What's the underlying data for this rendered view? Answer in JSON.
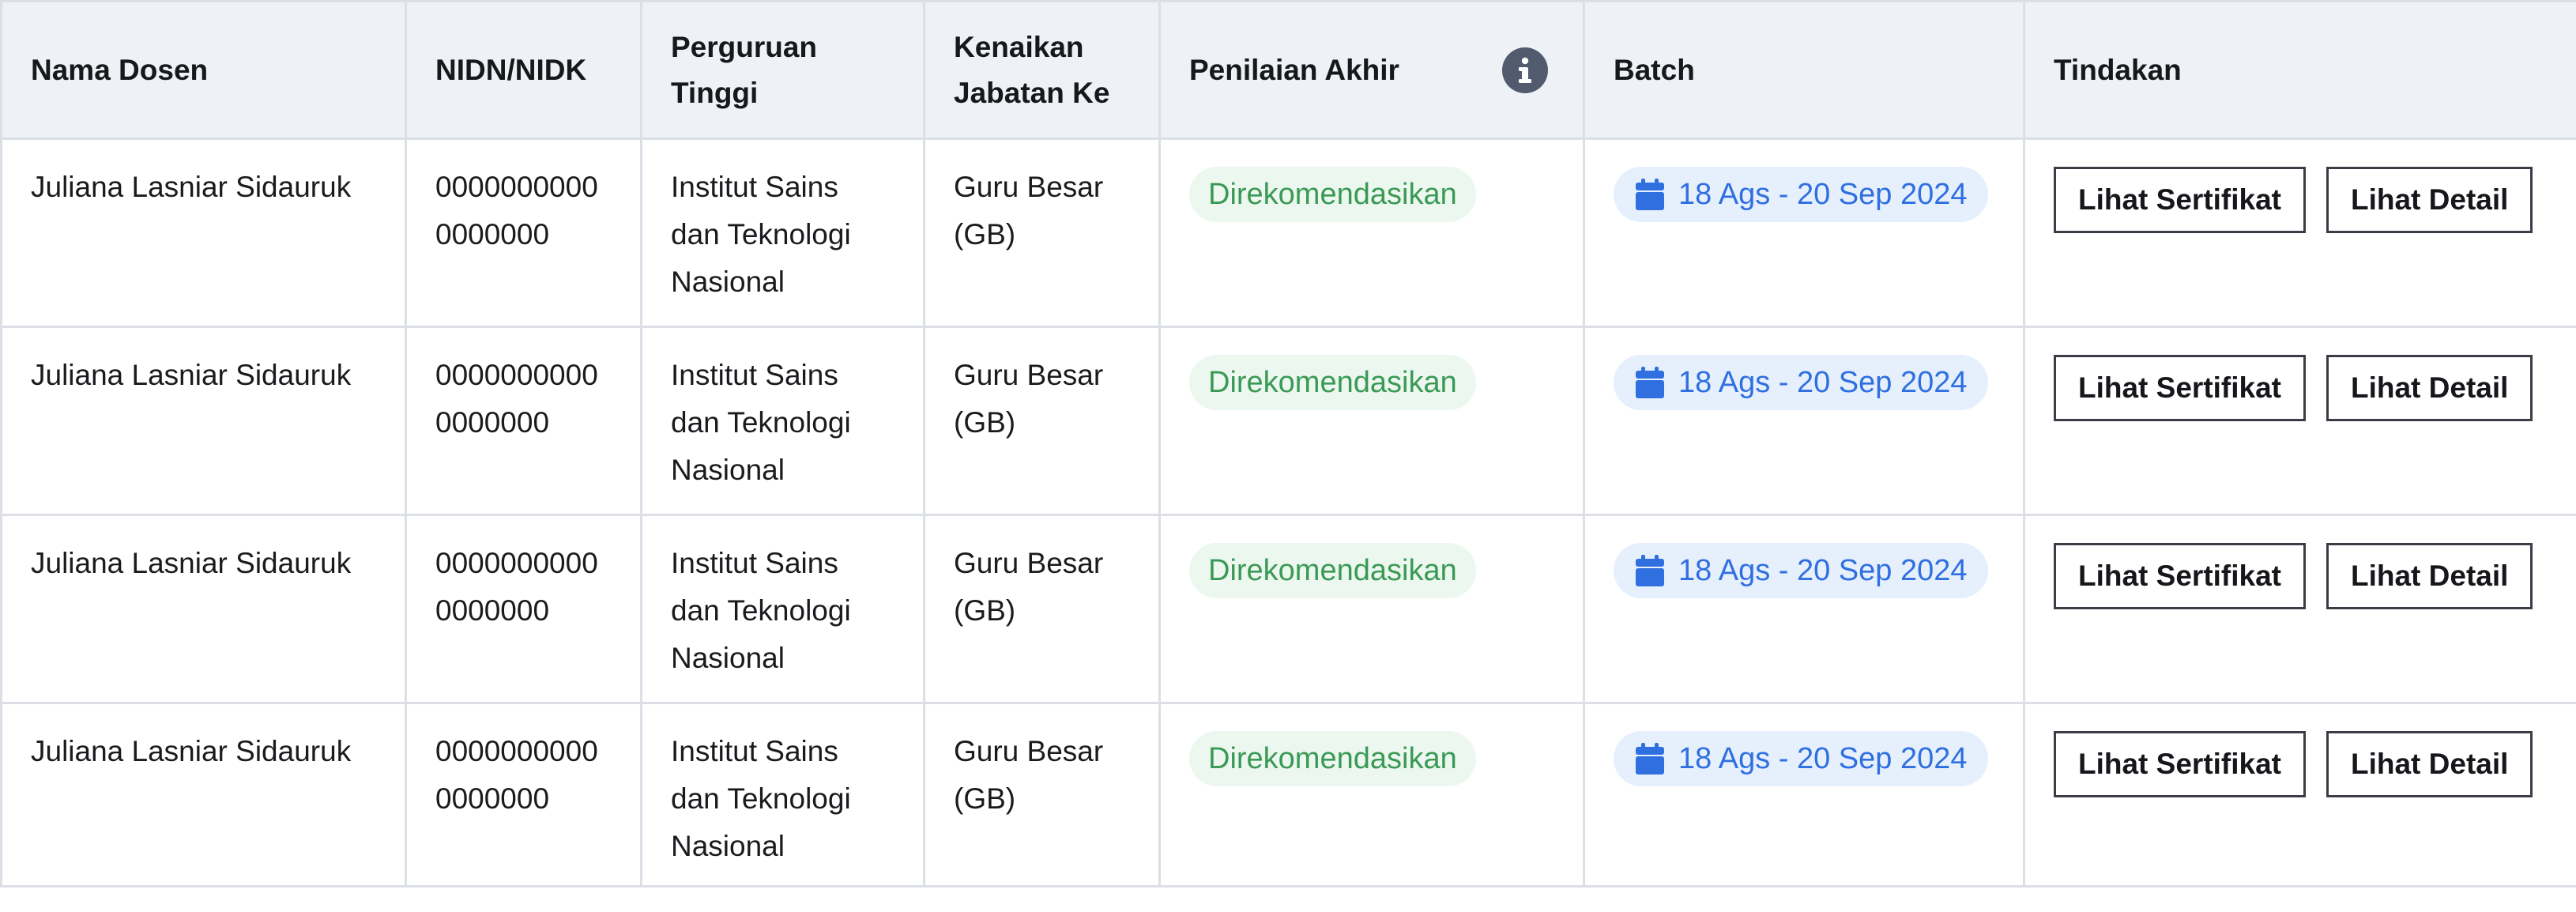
{
  "table": {
    "headers": {
      "nama_dosen": "Nama Dosen",
      "nidn": "NIDN/NIDK",
      "perguruan": "Perguruan\nTinggi",
      "kenaikan": "Kenaikan\nJabatan Ke",
      "penilaian": "Penilaian Akhir",
      "batch": "Batch",
      "tindakan": "Tindakan"
    },
    "header_icons": {
      "penilaian": "info-icon"
    },
    "rows": [
      {
        "nama": "Juliana Lasniar Sidauruk",
        "nidn": "0000000000\n0000000",
        "perguruan": "Institut Sains\ndan Teknologi\nNasional",
        "kenaikan": "Guru Besar\n(GB)",
        "penilaian": "Direkomendasikan",
        "batch": "18 Ags - 20 Sep 2024",
        "btn_sertifikat": "Lihat Sertifikat",
        "btn_detail": "Lihat Detail"
      },
      {
        "nama": "Juliana Lasniar Sidauruk",
        "nidn": "0000000000\n0000000",
        "perguruan": "Institut Sains\ndan Teknologi\nNasional",
        "kenaikan": "Guru Besar\n(GB)",
        "penilaian": "Direkomendasikan",
        "batch": "18 Ags - 20 Sep 2024",
        "btn_sertifikat": "Lihat Sertifikat",
        "btn_detail": "Lihat Detail"
      },
      {
        "nama": "Juliana Lasniar Sidauruk",
        "nidn": "0000000000\n0000000",
        "perguruan": "Institut Sains\ndan Teknologi\nNasional",
        "kenaikan": "Guru Besar\n(GB)",
        "penilaian": "Direkomendasikan",
        "batch": "18 Ags - 20 Sep 2024",
        "btn_sertifikat": "Lihat Sertifikat",
        "btn_detail": "Lihat Detail"
      },
      {
        "nama": "Juliana Lasniar Sidauruk",
        "nidn": "0000000000\n0000000",
        "perguruan": "Institut Sains\ndan Teknologi\nNasional",
        "kenaikan": "Guru Besar\n(GB)",
        "penilaian": "Direkomendasikan",
        "batch": "18 Ags - 20 Sep 2024",
        "btn_sertifikat": "Lihat Sertifikat",
        "btn_detail": "Lihat Detail"
      }
    ]
  },
  "icons": {
    "batch": "calendar-icon"
  },
  "colors": {
    "header_bg": "#eef1f5",
    "border": "#dcdfe6",
    "badge_green_bg": "#ecf7ef",
    "badge_green_text": "#3a9a55",
    "badge_blue_bg": "#e6f0fd",
    "badge_blue_text": "#2f6fe0",
    "info_icon_bg": "#525a6e"
  }
}
